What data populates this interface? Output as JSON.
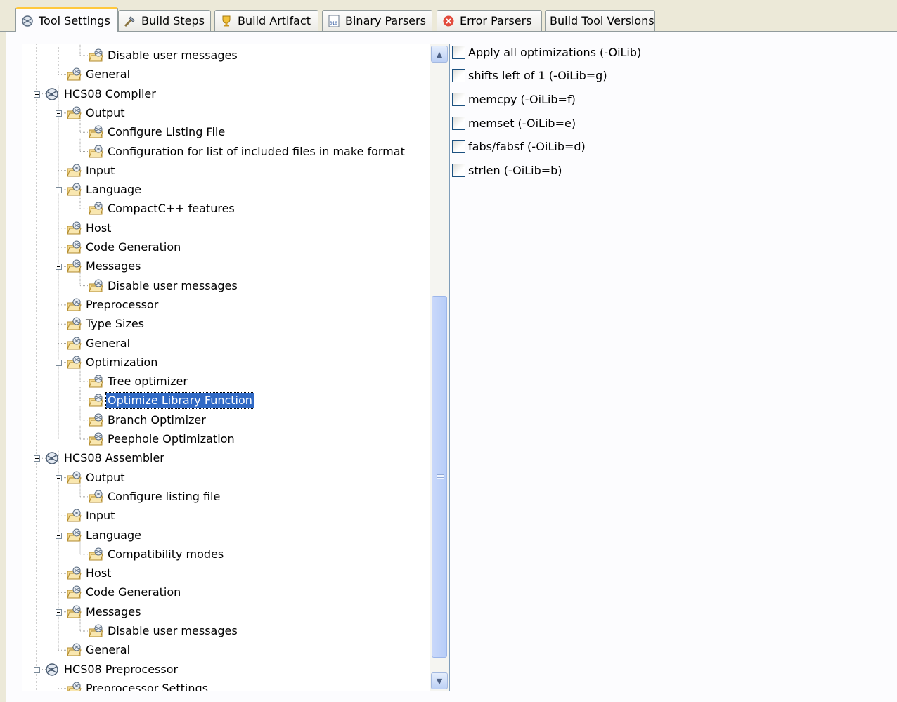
{
  "tabs": [
    {
      "label": "Tool Settings",
      "icon": "tool-settings-icon",
      "active": true
    },
    {
      "label": "Build Steps",
      "icon": "build-steps-icon",
      "active": false
    },
    {
      "label": "Build Artifact",
      "icon": "trophy-icon",
      "active": false
    },
    {
      "label": "Binary Parsers",
      "icon": "binary-icon",
      "active": false
    },
    {
      "label": "Error Parsers",
      "icon": "error-icon",
      "active": false
    },
    {
      "label": "Build Tool Versions",
      "icon": "",
      "active": false
    }
  ],
  "tree": [
    {
      "label": "Disable user messages",
      "level": 2,
      "type": "category"
    },
    {
      "label": "General",
      "level": 1,
      "type": "category"
    },
    {
      "label": "HCS08 Compiler",
      "level": 0,
      "type": "tool",
      "expanded": true
    },
    {
      "label": "Output",
      "level": 1,
      "type": "category",
      "expanded": true
    },
    {
      "label": "Configure Listing File",
      "level": 2,
      "type": "category"
    },
    {
      "label": "Configuration for list of included files in make format",
      "level": 2,
      "type": "category"
    },
    {
      "label": "Input",
      "level": 1,
      "type": "category"
    },
    {
      "label": "Language",
      "level": 1,
      "type": "category",
      "expanded": true
    },
    {
      "label": "CompactC++ features",
      "level": 2,
      "type": "category"
    },
    {
      "label": "Host",
      "level": 1,
      "type": "category"
    },
    {
      "label": "Code Generation",
      "level": 1,
      "type": "category"
    },
    {
      "label": "Messages",
      "level": 1,
      "type": "category",
      "expanded": true
    },
    {
      "label": "Disable user messages",
      "level": 2,
      "type": "category"
    },
    {
      "label": "Preprocessor",
      "level": 1,
      "type": "category"
    },
    {
      "label": "Type Sizes",
      "level": 1,
      "type": "category"
    },
    {
      "label": "General",
      "level": 1,
      "type": "category"
    },
    {
      "label": "Optimization",
      "level": 1,
      "type": "category",
      "expanded": true
    },
    {
      "label": "Tree optimizer",
      "level": 2,
      "type": "category"
    },
    {
      "label": "Optimize Library Function",
      "level": 2,
      "type": "category",
      "selected": true
    },
    {
      "label": "Branch Optimizer",
      "level": 2,
      "type": "category"
    },
    {
      "label": "Peephole Optimization",
      "level": 2,
      "type": "category"
    },
    {
      "label": "HCS08 Assembler",
      "level": 0,
      "type": "tool",
      "expanded": true
    },
    {
      "label": "Output",
      "level": 1,
      "type": "category",
      "expanded": true
    },
    {
      "label": "Configure listing file",
      "level": 2,
      "type": "category"
    },
    {
      "label": "Input",
      "level": 1,
      "type": "category"
    },
    {
      "label": "Language",
      "level": 1,
      "type": "category",
      "expanded": true
    },
    {
      "label": "Compatibility modes",
      "level": 2,
      "type": "category"
    },
    {
      "label": "Host",
      "level": 1,
      "type": "category"
    },
    {
      "label": "Code Generation",
      "level": 1,
      "type": "category"
    },
    {
      "label": "Messages",
      "level": 1,
      "type": "category",
      "expanded": true
    },
    {
      "label": "Disable user messages",
      "level": 2,
      "type": "category"
    },
    {
      "label": "General",
      "level": 1,
      "type": "category"
    },
    {
      "label": "HCS08 Preprocessor",
      "level": 0,
      "type": "tool",
      "expanded": true
    },
    {
      "label": "Preprocessor Settings",
      "level": 1,
      "type": "category"
    }
  ],
  "options": [
    {
      "label": "Apply all optimizations (-OiLib)",
      "checked": false
    },
    {
      "label": "shifts left of 1 (-OiLib=g)",
      "checked": false
    },
    {
      "label": "memcpy (-OiLib=f)",
      "checked": false
    },
    {
      "label": "memset (-OiLib=e)",
      "checked": false
    },
    {
      "label": "fabs/fabsf (-OiLib=d)",
      "checked": false
    },
    {
      "label": "strlen (-OiLib=b)",
      "checked": false
    }
  ],
  "scrollbar": {
    "position": 0.39,
    "visible_fraction": 0.57
  },
  "colors": {
    "selection": "#316ac5",
    "active_tab_accent": "#ffc83c",
    "panel": "#ece9d8",
    "tree_border": "#7f9db9"
  }
}
